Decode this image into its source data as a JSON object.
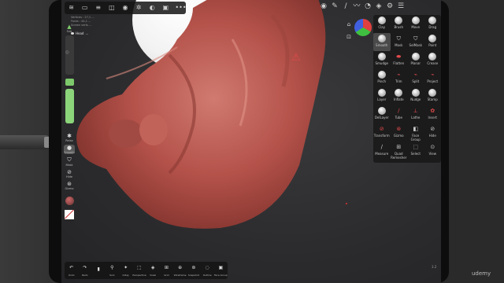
{
  "app": {
    "mesh_info": [
      "Vertices : 27,1 ...",
      "Faces : 44,1 ...",
      "Screen verts ..."
    ],
    "mesh_name": "Head",
    "mesh_detail": "...",
    "corner_number": "3.2",
    "watermark": "udemy"
  },
  "top_toolbar": [
    {
      "icon": "menu-icon"
    },
    {
      "icon": "folder-icon"
    },
    {
      "icon": "layers-icon"
    },
    {
      "icon": "scene-icon"
    },
    {
      "icon": "sphere-icon"
    },
    {
      "icon": "settings-icon"
    },
    {
      "icon": "material-icon"
    },
    {
      "icon": "image-icon"
    },
    {
      "icon": "more-icon"
    }
  ],
  "top_right_icons": [
    {
      "icon": "color-picker-icon"
    },
    {
      "icon": "pen-icon"
    },
    {
      "icon": "brush-settings-icon"
    },
    {
      "icon": "stroke-icon"
    },
    {
      "icon": "pressure-icon"
    },
    {
      "icon": "layers-stack-icon"
    },
    {
      "icon": "gear-icon"
    },
    {
      "icon": "list-icon"
    }
  ],
  "left_bar": {
    "top_label": "Sub",
    "relax_label": "Relax",
    "smooth_label": "Smooth",
    "mask_label": "Mask",
    "hide_label": "Hide",
    "gizmo_label": "Gizmo"
  },
  "bottom_bar": [
    {
      "label": "Undo",
      "icon": "undo-icon"
    },
    {
      "label": "Redo",
      "icon": "redo-icon"
    },
    {
      "label": "",
      "icon": "device-icon"
    },
    {
      "label": "Solo",
      "icon": "solo-icon"
    },
    {
      "label": "X-Ray",
      "icon": "xray-icon"
    },
    {
      "label": "Perspective",
      "icon": "perspective-icon"
    },
    {
      "label": "Voxel",
      "icon": "voxel-icon"
    },
    {
      "label": "Grid",
      "icon": "grid-icon"
    },
    {
      "label": "Wireframe",
      "icon": "wireframe-icon"
    },
    {
      "label": "Snapshot",
      "icon": "snapshot-icon"
    },
    {
      "label": "Outline",
      "icon": "outline-icon"
    },
    {
      "label": "Face Group",
      "icon": "facegroup-icon"
    }
  ],
  "tools": [
    {
      "label": "Clay",
      "icon": "sphere"
    },
    {
      "label": "Brush",
      "icon": "sphere"
    },
    {
      "label": "Move",
      "icon": "sphere"
    },
    {
      "label": "Drag",
      "icon": "sphere"
    },
    {
      "label": "Smooth",
      "icon": "sphere",
      "active": true
    },
    {
      "label": "Mask",
      "icon": "shield"
    },
    {
      "label": "SelMask",
      "icon": "shield"
    },
    {
      "label": "Paint",
      "icon": "sphere"
    },
    {
      "label": "Smudge",
      "icon": "sphere"
    },
    {
      "label": "Flatten",
      "icon": "flatten"
    },
    {
      "label": "Planar",
      "icon": "sphere"
    },
    {
      "label": "Crease",
      "icon": "sphere"
    },
    {
      "label": "Pinch",
      "icon": "sphere"
    },
    {
      "label": "Trim",
      "icon": "cut"
    },
    {
      "label": "Split",
      "icon": "cut"
    },
    {
      "label": "Project",
      "icon": "cut"
    },
    {
      "label": "Layer",
      "icon": "sphere"
    },
    {
      "label": "Inflate",
      "icon": "sphere"
    },
    {
      "label": "Nudge",
      "icon": "sphere"
    },
    {
      "label": "Stamp",
      "icon": "sphere"
    },
    {
      "label": "DelLayer",
      "icon": "sphere"
    },
    {
      "label": "Tube",
      "icon": "tube"
    },
    {
      "label": "Lathe",
      "icon": "lathe"
    },
    {
      "label": "Insert",
      "icon": "insert"
    },
    {
      "label": "Transform",
      "icon": "transform"
    },
    {
      "label": "Gizmo",
      "icon": "gizmo"
    },
    {
      "label": "Face Group",
      "icon": "facegroup"
    },
    {
      "label": "Hide",
      "icon": "hide"
    },
    {
      "label": "Measure",
      "icon": "measure"
    },
    {
      "label": "Quad Remesher",
      "icon": "remesher"
    },
    {
      "label": "Select",
      "icon": "select"
    },
    {
      "label": "View",
      "icon": "camera"
    }
  ],
  "colors": {
    "accent_green": "#8bd47a",
    "mesh_red": "#b4524a",
    "panel_bg": "#191919",
    "cursor_red": "#e04a4a"
  }
}
